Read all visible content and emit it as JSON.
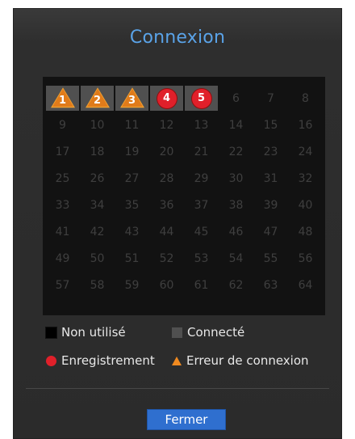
{
  "dialog": {
    "title": "Connexion"
  },
  "channels": [
    {
      "label": "1",
      "state": "error"
    },
    {
      "label": "2",
      "state": "error"
    },
    {
      "label": "3",
      "state": "error"
    },
    {
      "label": "4",
      "state": "recording"
    },
    {
      "label": "5",
      "state": "recording"
    },
    {
      "label": "6",
      "state": "unused"
    },
    {
      "label": "7",
      "state": "unused"
    },
    {
      "label": "8",
      "state": "unused"
    },
    {
      "label": "9",
      "state": "unused"
    },
    {
      "label": "10",
      "state": "unused"
    },
    {
      "label": "11",
      "state": "unused"
    },
    {
      "label": "12",
      "state": "unused"
    },
    {
      "label": "13",
      "state": "unused"
    },
    {
      "label": "14",
      "state": "unused"
    },
    {
      "label": "15",
      "state": "unused"
    },
    {
      "label": "16",
      "state": "unused"
    },
    {
      "label": "17",
      "state": "unused"
    },
    {
      "label": "18",
      "state": "unused"
    },
    {
      "label": "19",
      "state": "unused"
    },
    {
      "label": "20",
      "state": "unused"
    },
    {
      "label": "21",
      "state": "unused"
    },
    {
      "label": "22",
      "state": "unused"
    },
    {
      "label": "23",
      "state": "unused"
    },
    {
      "label": "24",
      "state": "unused"
    },
    {
      "label": "25",
      "state": "unused"
    },
    {
      "label": "26",
      "state": "unused"
    },
    {
      "label": "27",
      "state": "unused"
    },
    {
      "label": "28",
      "state": "unused"
    },
    {
      "label": "29",
      "state": "unused"
    },
    {
      "label": "30",
      "state": "unused"
    },
    {
      "label": "31",
      "state": "unused"
    },
    {
      "label": "32",
      "state": "unused"
    },
    {
      "label": "33",
      "state": "unused"
    },
    {
      "label": "34",
      "state": "unused"
    },
    {
      "label": "35",
      "state": "unused"
    },
    {
      "label": "36",
      "state": "unused"
    },
    {
      "label": "37",
      "state": "unused"
    },
    {
      "label": "38",
      "state": "unused"
    },
    {
      "label": "39",
      "state": "unused"
    },
    {
      "label": "40",
      "state": "unused"
    },
    {
      "label": "41",
      "state": "unused"
    },
    {
      "label": "42",
      "state": "unused"
    },
    {
      "label": "43",
      "state": "unused"
    },
    {
      "label": "44",
      "state": "unused"
    },
    {
      "label": "45",
      "state": "unused"
    },
    {
      "label": "46",
      "state": "unused"
    },
    {
      "label": "47",
      "state": "unused"
    },
    {
      "label": "48",
      "state": "unused"
    },
    {
      "label": "49",
      "state": "unused"
    },
    {
      "label": "50",
      "state": "unused"
    },
    {
      "label": "51",
      "state": "unused"
    },
    {
      "label": "52",
      "state": "unused"
    },
    {
      "label": "53",
      "state": "unused"
    },
    {
      "label": "54",
      "state": "unused"
    },
    {
      "label": "55",
      "state": "unused"
    },
    {
      "label": "56",
      "state": "unused"
    },
    {
      "label": "57",
      "state": "unused"
    },
    {
      "label": "58",
      "state": "unused"
    },
    {
      "label": "59",
      "state": "unused"
    },
    {
      "label": "60",
      "state": "unused"
    },
    {
      "label": "61",
      "state": "unused"
    },
    {
      "label": "62",
      "state": "unused"
    },
    {
      "label": "63",
      "state": "unused"
    },
    {
      "label": "64",
      "state": "unused"
    }
  ],
  "legend": {
    "unused": "Non utilisé",
    "connected": "Connecté",
    "recording": "Enregistrement",
    "error": "Erreur de connexion"
  },
  "buttons": {
    "close": "Fermer"
  },
  "colors": {
    "title": "#5aa3e8",
    "recording": "#e0202a",
    "error": "#e07b1a",
    "button": "#2f6fcf"
  }
}
